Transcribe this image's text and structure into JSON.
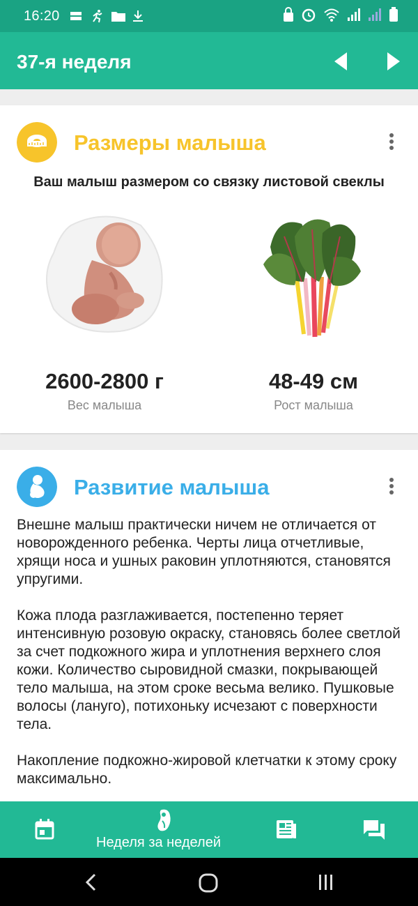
{
  "status_bar": {
    "time": "16:20"
  },
  "app_bar": {
    "title": "37-я неделя"
  },
  "baby_size": {
    "title": "Размеры малыша",
    "title_color": "#f7c42b",
    "comparison": "Ваш малыш размером со связку листовой свеклы",
    "weight_value": "2600-2800 г",
    "weight_label": "Вес малыша",
    "height_value": "48-49 см",
    "height_label": "Рост малыша"
  },
  "baby_development": {
    "title": "Развитие малыша",
    "title_color": "#3aaee8",
    "paragraphs": [
      "Внешне малыш практически ничем не отличается от новорожденного ребенка. Черты лица отчетливые, хрящи носа и ушных раковин уплотняются, становятся упругими.",
      "Кожа плода разглаживается, постепенно теряет интенсивную розовую окраску, становясь более светлой за счет подкожного жира и уплотнения верхнего слоя кожи. Количество сыровидной смазки, покрывающей тело малыша, на этом сроке весьма велико. Пушковые волосы (лануго), потихоньку исчезают с поверхности тела.",
      "Накопление подкожно-жировой клетчатки к этому сроку максимально."
    ]
  },
  "bottom_nav": {
    "active_label": "Неделя за неделей",
    "items": [
      "calendar-icon",
      "baby-foot-icon",
      "articles-icon",
      "chat-icon"
    ]
  },
  "colors": {
    "primary": "#22b995",
    "status_bar": "#1aa383",
    "background": "#eeeeee"
  }
}
